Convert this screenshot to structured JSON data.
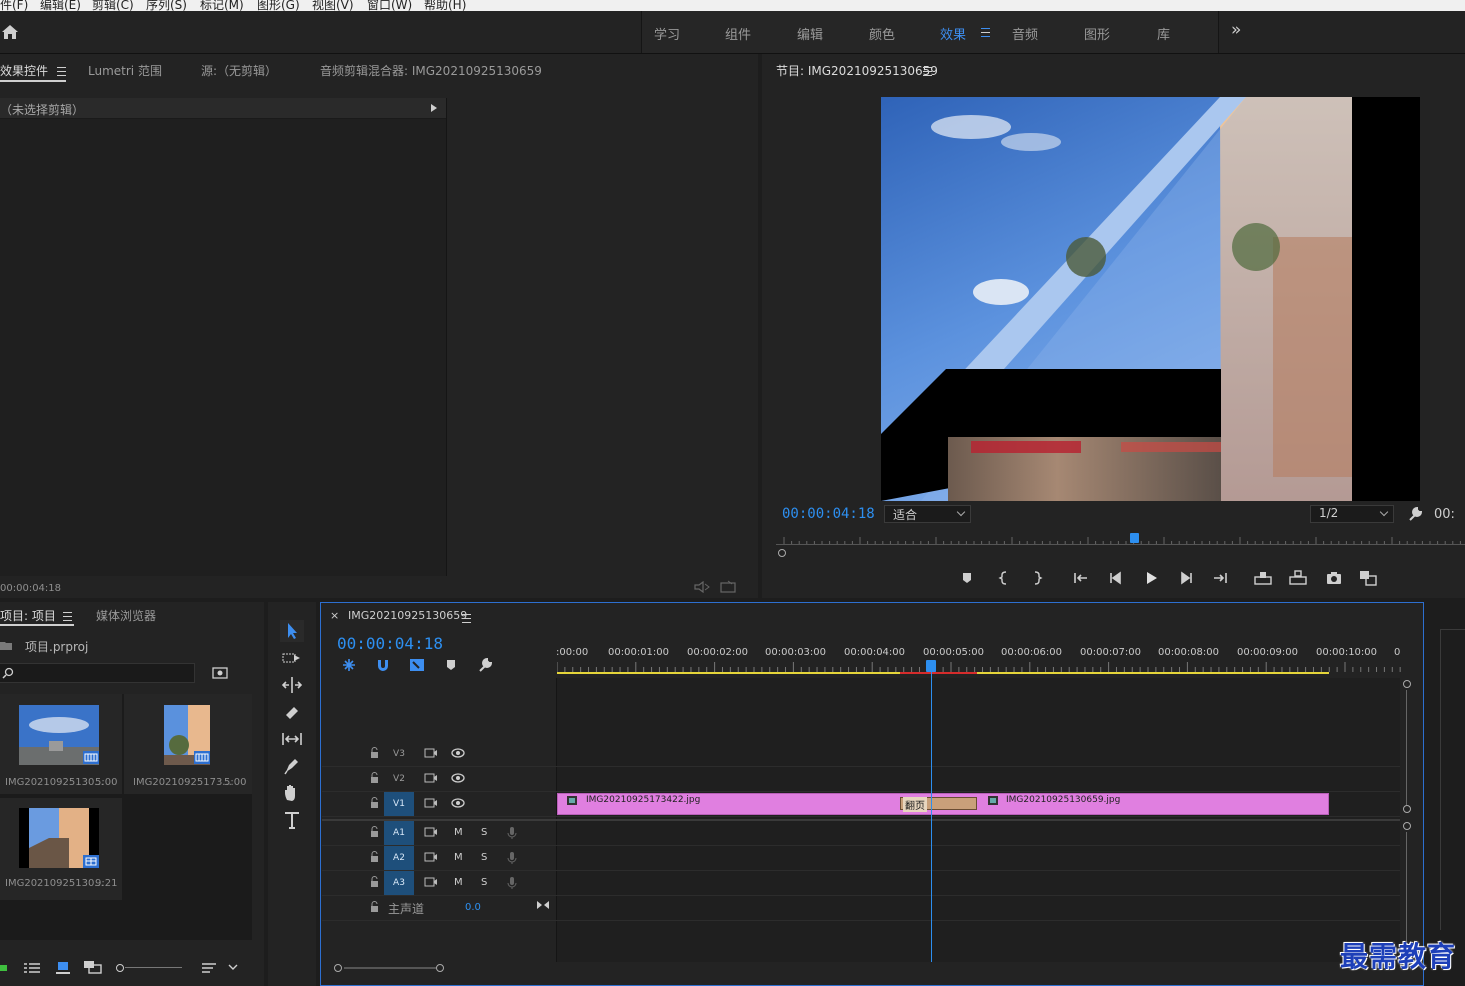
{
  "menu": [
    "件(F)",
    "编辑(E)",
    "剪辑(C)",
    "序列(S)",
    "标记(M)",
    "图形(G)",
    "视图(V)",
    "窗口(W)",
    "帮助(H)"
  ],
  "workspaces": {
    "tabs": [
      "学习",
      "组件",
      "编辑",
      "颜色",
      "效果",
      "音频",
      "图形",
      "库"
    ],
    "active": "效果",
    "overflow": "»"
  },
  "source_panel": {
    "tabs": [
      "效果控件",
      "Lumetri 范围",
      "源:（无剪辑）",
      "音频剪辑混合器: IMG20210925130659"
    ],
    "no_clip": "（未选择剪辑）",
    "timecode": "00:00:04:18"
  },
  "program": {
    "title": "节目: IMG20210925130659",
    "timecode": "00:00:04:18",
    "fit": "适合",
    "resolution": "1/2",
    "timecode_right": "00:",
    "playhead_fraction": 0.52
  },
  "project": {
    "tabs": [
      "项目: 项目",
      "媒体浏览器"
    ],
    "file": "项目.prproj",
    "search_placeholder": "",
    "items": [
      {
        "name": "IMG20210925130...",
        "duration": "5:00"
      },
      {
        "name": "IMG20210925173...",
        "duration": "5:00"
      },
      {
        "name": "IMG20210925130...",
        "duration": "9:21"
      }
    ]
  },
  "timeline": {
    "sequence_name": "IMG20210925130659",
    "timecode": "00:00:04:18",
    "ruler": [
      ":00:00",
      "00:00:01:00",
      "00:00:02:00",
      "00:00:03:00",
      "00:00:04:00",
      "00:00:05:00",
      "00:00:06:00",
      "00:00:07:00",
      "00:00:08:00",
      "00:00:09:00",
      "00:00:10:00",
      "0"
    ],
    "video_tracks": [
      "V3",
      "V2",
      "V1"
    ],
    "audio_tracks": [
      "A1",
      "A2",
      "A3"
    ],
    "audio_toggles": {
      "mute": "M",
      "solo": "S"
    },
    "master_label": "主声道",
    "master_value": "0.0",
    "clips": [
      {
        "name": "IMG20210925173422.jpg"
      },
      {
        "name": "IMG20210925130659.jpg"
      }
    ],
    "transition": "翻页",
    "playhead_seconds": 4.75
  },
  "watermark": "最需教育",
  "colors": {
    "accent": "#2d8ff0",
    "clip": "#e07fe0",
    "work_area": "#e5d53a",
    "render_red": "#d62c2c",
    "transition": "#c9a07a"
  }
}
